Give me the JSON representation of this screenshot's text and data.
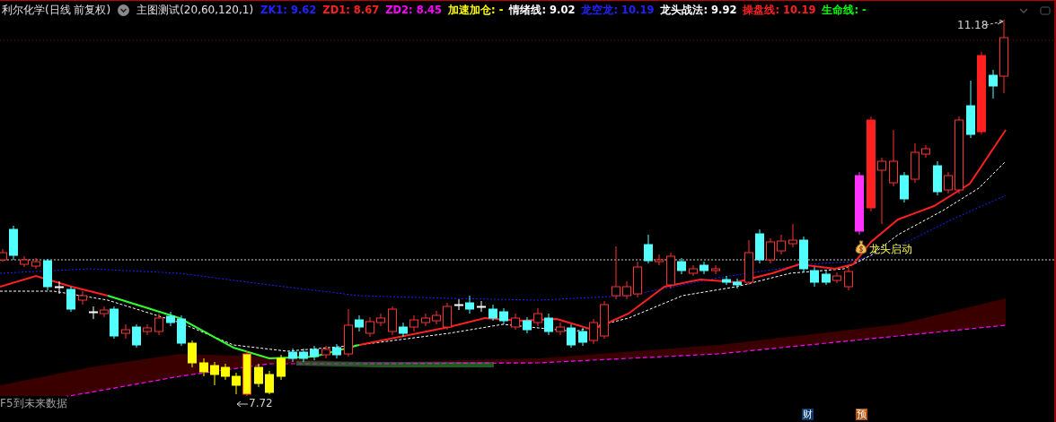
{
  "header": {
    "stock": "利尔化学(日线 前复权)",
    "indicator": "主图测试(20,60,120,1)",
    "values": [
      {
        "text": "ZK1: 9.62",
        "color": "#2222ff"
      },
      {
        "text": "ZD1: 8.67",
        "color": "#ff2020"
      },
      {
        "text": "ZD2: 8.45",
        "color": "#ff00ff"
      },
      {
        "text": "加速加仓: -",
        "color": "#ffff00"
      },
      {
        "text": "情绪线: 9.02",
        "color": "#ffffff"
      },
      {
        "text": "龙空龙: 10.19",
        "color": "#2222ff"
      },
      {
        "text": "龙头战法: 9.92",
        "color": "#ffffff"
      },
      {
        "text": "操盘线: 10.19",
        "color": "#ff2020"
      },
      {
        "text": "生命线: -",
        "color": "#00ff00"
      }
    ]
  },
  "chart": {
    "high_label": "11.18",
    "low_label": "7.72",
    "signal_label": "龙头启动",
    "footer_text": "F5到未来数据",
    "markers": [
      {
        "text": "财",
        "color": "#0b3b6e"
      },
      {
        "text": "预",
        "color": "#b4520e"
      }
    ]
  }
}
